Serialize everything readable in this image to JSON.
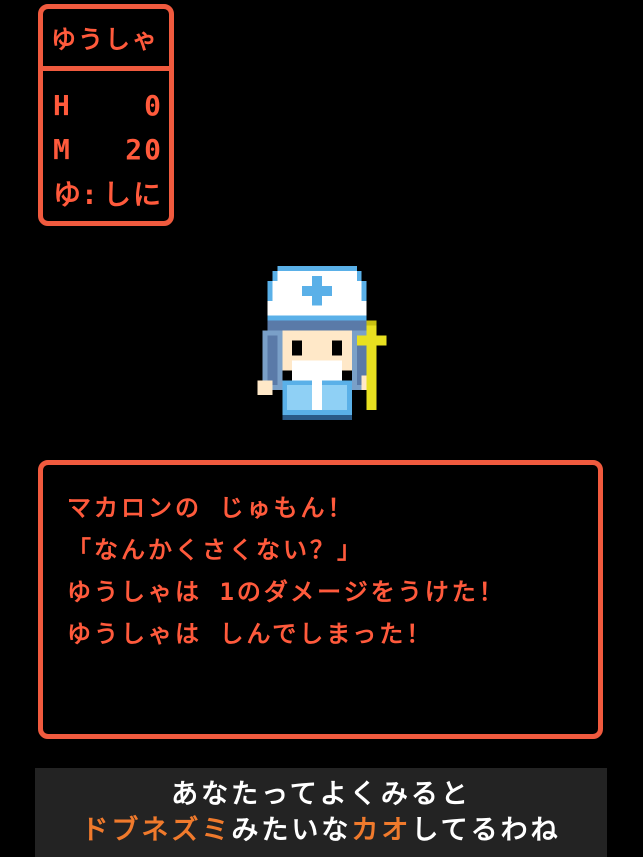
{
  "status": {
    "name": "ゆうしゃ",
    "rows": [
      {
        "label": "H",
        "value": "0"
      },
      {
        "label": "M",
        "value": "20"
      },
      {
        "label": "ゆ:",
        "value": "しに"
      }
    ]
  },
  "character": {
    "icon": "cleric-sprite-icon"
  },
  "message": {
    "lines": [
      "マカロンの じゅもん！",
      "「なんかくさくない？」",
      "ゆうしゃは 1のダメージをうけた！",
      "ゆうしゃは しんでしまった！"
    ]
  },
  "caption": {
    "line1": "あなたってよくみると",
    "line2_parts": [
      {
        "text": "ドブネズミ",
        "highlight": true
      },
      {
        "text": "みたいな",
        "highlight": false
      },
      {
        "text": "カオ",
        "highlight": true
      },
      {
        "text": "してるわね",
        "highlight": false
      }
    ]
  },
  "colors": {
    "frame": "#f05a3e",
    "text": "#ff5a3c",
    "caption_highlight": "#f07a2c",
    "caption_bg": "#232323",
    "background": "#000000"
  }
}
